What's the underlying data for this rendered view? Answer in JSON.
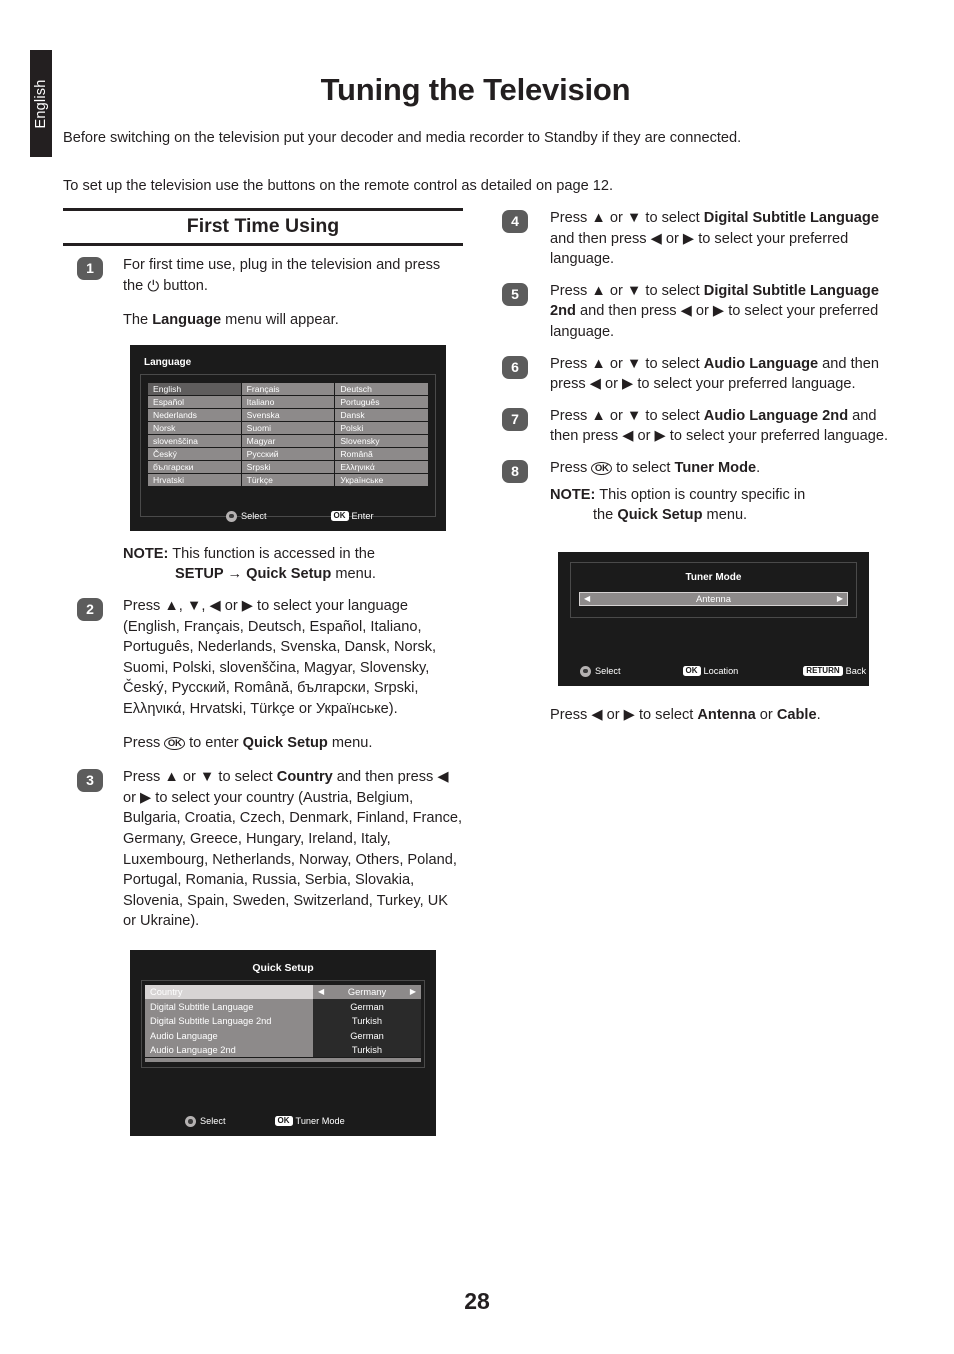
{
  "side_tab": {
    "label": "English"
  },
  "page": {
    "title": "Tuning the Television",
    "number": "28"
  },
  "intro": {
    "paragraph1": "Before switching on the television put your decoder and media recorder to Standby if they are connected.",
    "paragraph2": "To set up the television use the buttons on the remote control as detailed on page 12."
  },
  "section": {
    "header": "First Time Using"
  },
  "steps": {
    "s1": {
      "number": "1",
      "line1_a": "For first time use, plug in the television and press the ",
      "power_icon": "⏻",
      "line1_b": " button.",
      "line2_a": "The ",
      "line2_bold": "Language",
      "line2_b": " menu will appear."
    },
    "note1": {
      "label": "NOTE:",
      "body": " This function is accessed in the",
      "cont_bold1": "SETUP",
      "cont_arrow": " → ",
      "cont_bold2": "Quick Setup",
      "cont_tail": " menu."
    },
    "s2": {
      "number": "2",
      "text": "Press ▲, ▼, ◀ or ▶ to select your language (English, Français, Deutsch, Español, Italiano, Português, Nederlands, Svenska, Dansk, Norsk, Suomi, Polski, slovenščina, Magyar, Slovensky, Český, Русский, Română, български, Srpski, Ελληνικά, Hrvatski, Türkçe or Українське).",
      "sub_a": "Press ",
      "ok_icon": "OK",
      "sub_b": " to enter ",
      "sub_bold": "Quick Setup",
      "sub_c": " menu."
    },
    "s3": {
      "number": "3",
      "a": "Press ▲ or ▼ to select ",
      "bold": "Country",
      "b": " and then press ◀ or ▶ to select your country (Austria, Belgium, Bulgaria, Croatia, Czech, Denmark, Finland, France, Germany, Greece, Hungary, Ireland, Italy, Luxembourg, Netherlands, Norway, Others, Poland, Portugal, Romania, Russia, Serbia, Slovakia, Slovenia, Spain, Sweden, Switzerland, Turkey, UK or Ukraine)."
    },
    "s4": {
      "number": "4",
      "a": "Press ▲ or ▼ to select ",
      "bold": "Digital Subtitle Language",
      "b": " and then press ◀ or ▶ to select your preferred language."
    },
    "s5": {
      "number": "5",
      "a": "Press ▲ or ▼ to select ",
      "bold": "Digital Subtitle Language 2nd",
      "b": " and then press ◀ or ▶ to select your preferred language."
    },
    "s6": {
      "number": "6",
      "a": "Press ▲ or ▼ to select ",
      "bold": "Audio Language",
      "b": " and then press ◀ or ▶ to select your preferred language."
    },
    "s7": {
      "number": "7",
      "a": "Press ▲ or ▼ to select ",
      "bold": "Audio Language 2nd",
      "b": " and then press ◀ or ▶ to select your preferred language."
    },
    "s8": {
      "number": "8",
      "a": "Press ",
      "ok_icon": "OK",
      "b": " to select ",
      "bold": "Tuner Mode",
      "c": "."
    },
    "note2": {
      "label": "NOTE:",
      "body": " This option is country specific in",
      "cont_a": "the ",
      "cont_bold": "Quick Setup",
      "cont_b": " menu."
    },
    "after_tuner": {
      "a": "Press ◀ or ▶ to select ",
      "bold1": "Antenna",
      "b": " or ",
      "bold2": "Cable",
      "c": "."
    }
  },
  "osd_language": {
    "title": "Language",
    "cells": [
      "English",
      "Français",
      "Deutsch",
      "Español",
      "Italiano",
      "Português",
      "Nederlands",
      "Svenska",
      "Dansk",
      "Norsk",
      "Suomi",
      "Polski",
      "slovenščina",
      "Magyar",
      "Slovensky",
      "Český",
      "Русский",
      "Română",
      "български",
      "Srpski",
      "Ελληνικά",
      "Hrvatski",
      "Türkçe",
      "Українське"
    ],
    "selected_index": 0,
    "bar": {
      "select": "Select",
      "ok_key": "OK",
      "ok_label": "Enter"
    }
  },
  "osd_quicksetup": {
    "title": "Quick Setup",
    "rows": [
      {
        "label": "Country",
        "value": "Germany",
        "selected": true
      },
      {
        "label": "Digital Subtitle Language",
        "value": "German",
        "selected": false
      },
      {
        "label": "Digital Subtitle Language 2nd",
        "value": "Turkish",
        "selected": false
      },
      {
        "label": "Audio Language",
        "value": "German",
        "selected": false
      },
      {
        "label": "Audio Language 2nd",
        "value": "Turkish",
        "selected": false
      }
    ],
    "bar": {
      "select": "Select",
      "ok_key": "OK",
      "ok_label": "Tuner Mode"
    }
  },
  "osd_tuner": {
    "title": "Tuner Mode",
    "value": "Antenna",
    "bar": {
      "select": "Select",
      "ok_key": "OK",
      "ok_label": "Location",
      "return_key": "RETURN",
      "return_label": "Back"
    }
  },
  "colors": {
    "ink": "#231f20",
    "badge": "#5c5c5c",
    "osd_bg": "#1b1b1b",
    "osd_row": "#8d8a8a",
    "osd_selected": "#5f5d5d",
    "osd_highlight": "#d7d4d4"
  }
}
